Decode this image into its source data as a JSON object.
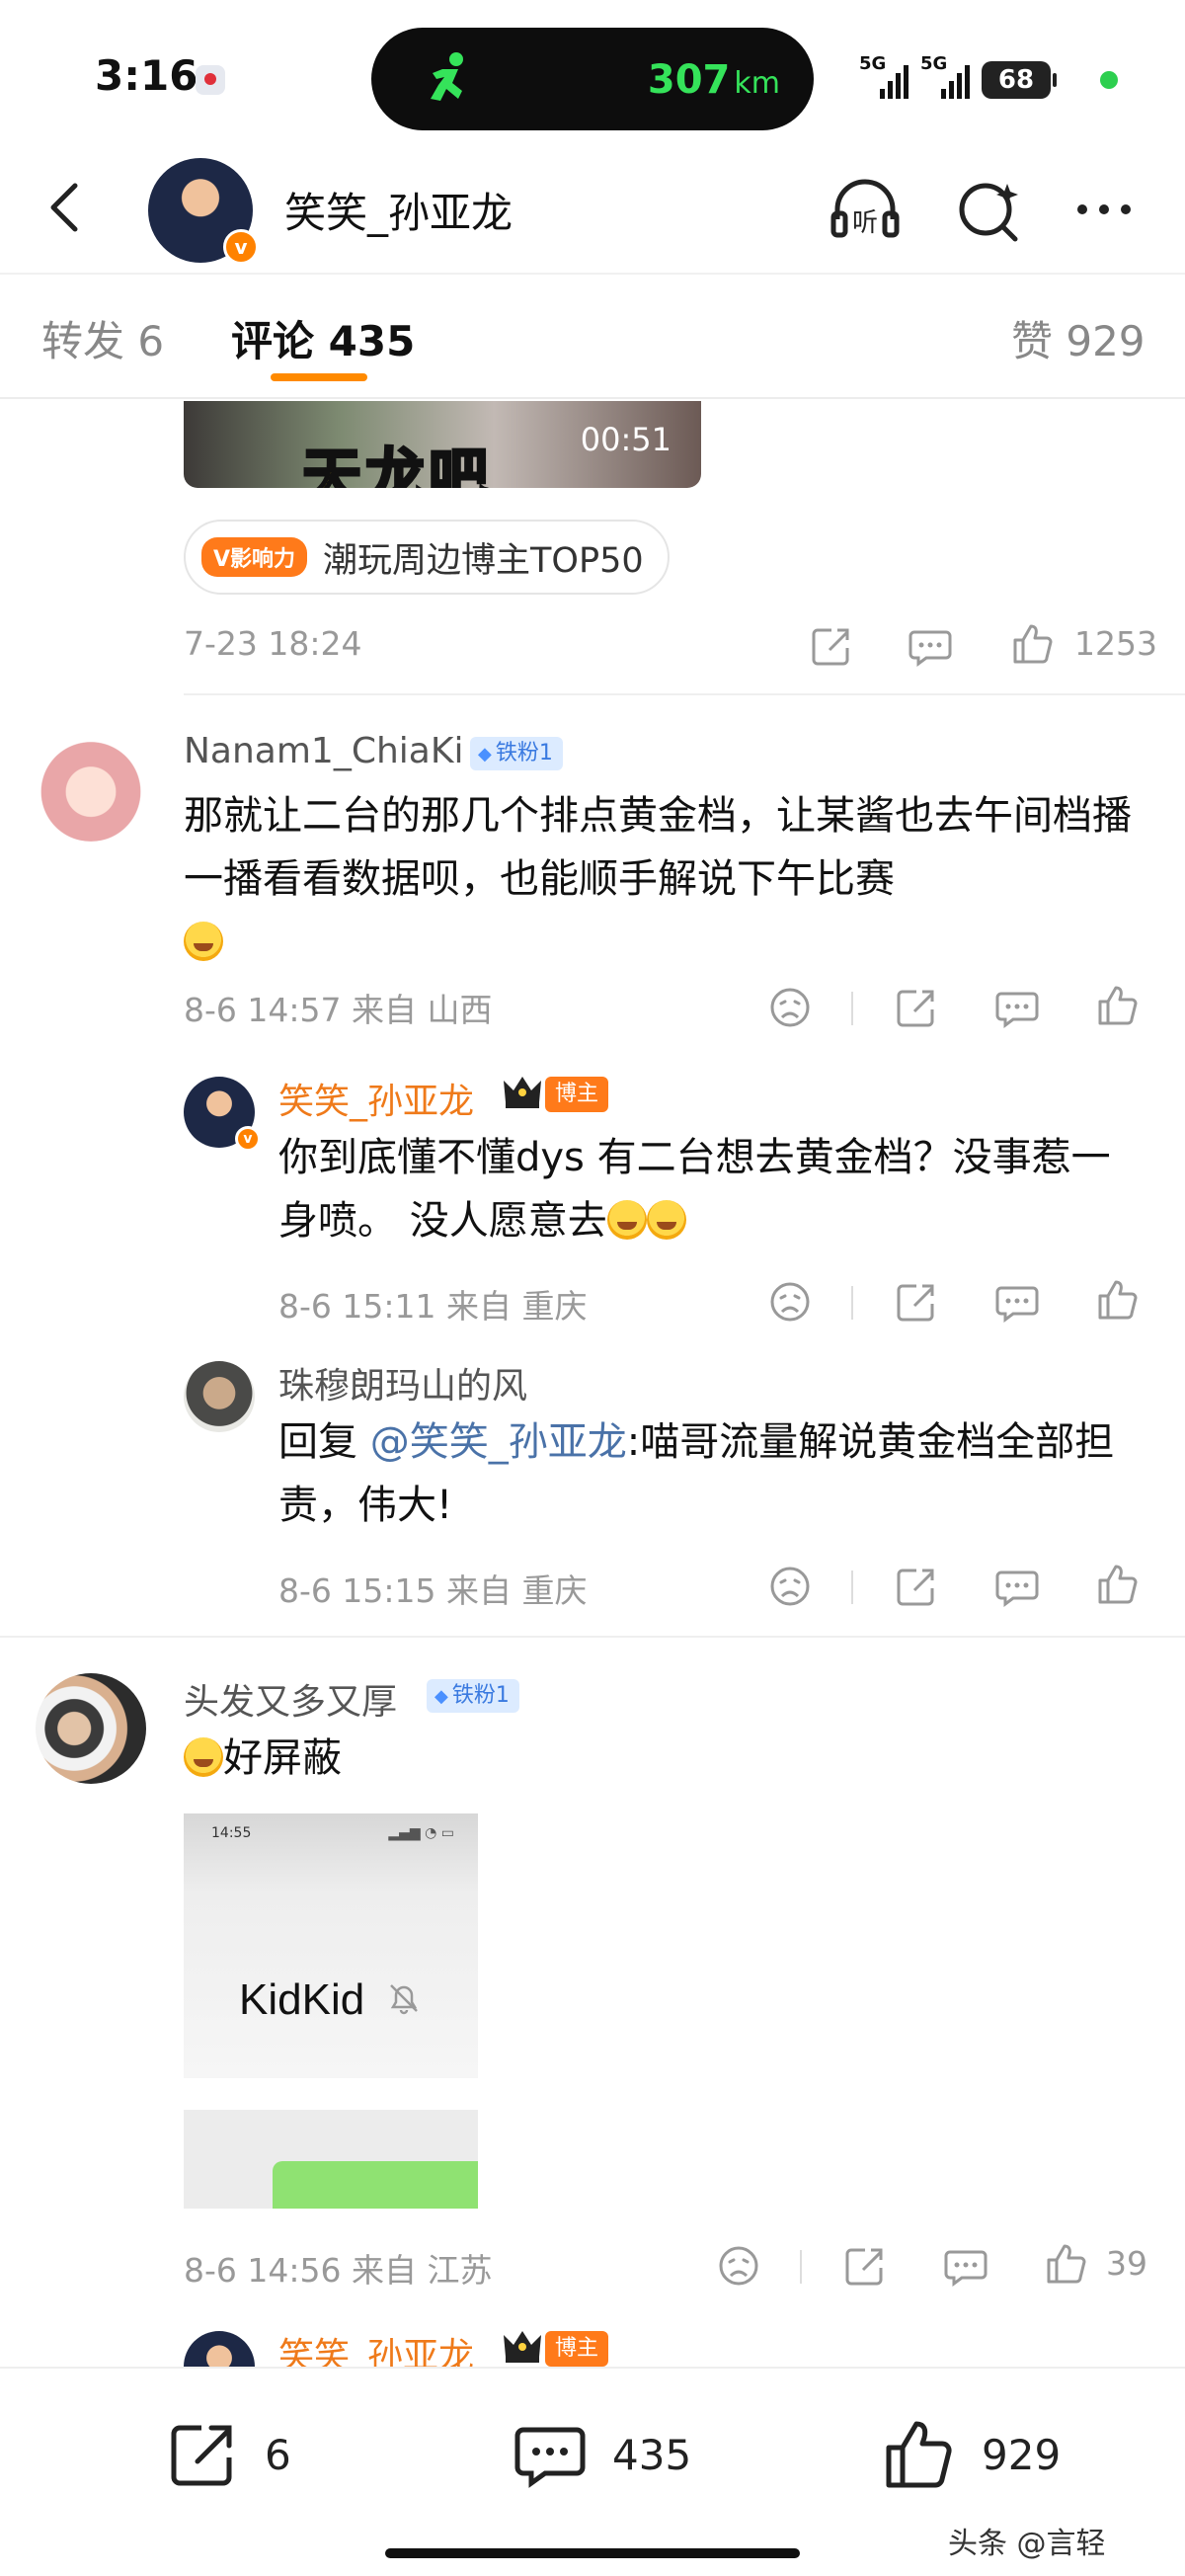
{
  "status_bar": {
    "time": "3:16",
    "distance_value": "307",
    "distance_unit": "km",
    "signal_1": "5G",
    "signal_2": "5G",
    "battery": "68"
  },
  "header": {
    "title": "笑笑_孙亚龙",
    "verified_badge": "v",
    "listen_icon_label": "听"
  },
  "tabs": {
    "repost": "转发 6",
    "comments": "评论 435",
    "likes": "赞 929",
    "active": "comments"
  },
  "post_tail": {
    "video_caption": "天龙吧",
    "video_duration": "00:51",
    "influence_badge": "V影响力",
    "influence_text": "潮玩周边博主TOP50",
    "timestamp": "7-23 18:24",
    "like_count": "1253"
  },
  "comments": [
    {
      "username": "Nanam1_ChiaKi",
      "fan_badge": "铁粉1",
      "text": "那就让二台的那几个排点黄金档，让某酱也去午间档播一播看看数据呗，也能顺手解说下午比赛",
      "meta": "8-6 14:57 来自 山西",
      "replies": [
        {
          "username": "笑笑_孙亚龙",
          "role_badge": "博主",
          "text": "你到底懂不懂dys 有二台想去黄金档？没事惹一身喷。 没人愿意去",
          "meta": "8-6 15:11 来自 重庆"
        },
        {
          "username": "珠穆朗玛山的风",
          "reply_prefix": "回复 ",
          "mention": "@笑笑_孙亚龙",
          "text": ":喵哥流量解说黄金档全部担责，伟大!",
          "meta": "8-6 15:15 来自 重庆"
        }
      ]
    },
    {
      "username": "头发又多又厚",
      "fan_badge": "铁粉1",
      "text": "好屏蔽",
      "image_text": "KidKid",
      "image_time": "14:55",
      "meta": "8-6 14:56 来自 江苏",
      "like_count": "39",
      "next_reply_username": "笑笑_孙亚龙",
      "next_reply_badge": "博主"
    }
  ],
  "bottom_bar": {
    "repost_count": "6",
    "comment_count": "435",
    "like_count": "929"
  },
  "watermark": "头条 @言轻",
  "colors": {
    "accent_orange": "#ff8a00",
    "author_name": "#ef7a1a",
    "fan_badge_bg": "#dcebff",
    "mention": "#4a72a8",
    "distance_green": "#35e35a"
  }
}
